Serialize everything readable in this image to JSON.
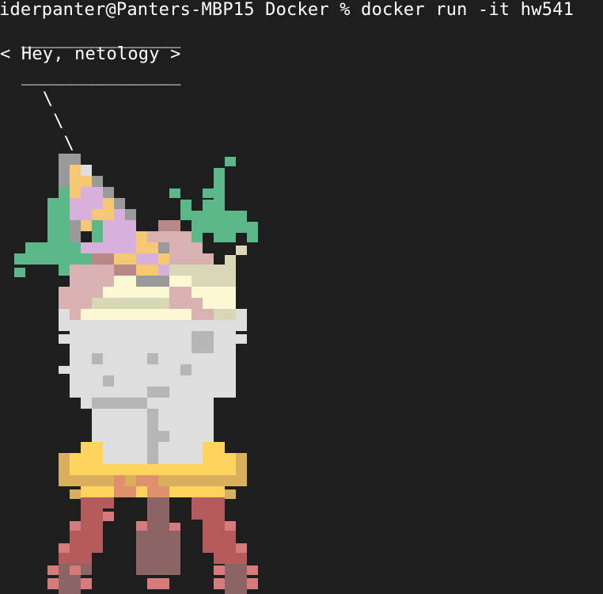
{
  "terminal": {
    "prompt": "iderpanter@Panters-MBP15 Docker % docker run -it hw541",
    "bubble_top": "  _______________",
    "bubble_text": "< Hey, netology >",
    "bubble_bottom": "  _______________",
    "tail_1": "    \\",
    "tail_2": "     \\",
    "tail_3": "      \\"
  },
  "art": {
    "description_icon": "pixel-art-parfait",
    "colors": {
      "background": "#1e1e1e",
      "green": "#5db889",
      "gray": "#9a9a9a",
      "peach": "#f7c873",
      "lilac": "#d8b0dc",
      "rose": "#b98787",
      "pink": "#d9b1b1",
      "cream": "#fbf8d3",
      "sage": "#d8d7b6",
      "glass": "#dedede",
      "glass_shadow": "#b6b6b6",
      "gold": "#fdd35d",
      "amber": "#d9ae5c",
      "coral": "#e0906c",
      "brick": "#b65b5b",
      "mauve": "#8c6464",
      "salmon": "#d67b7b"
    }
  }
}
